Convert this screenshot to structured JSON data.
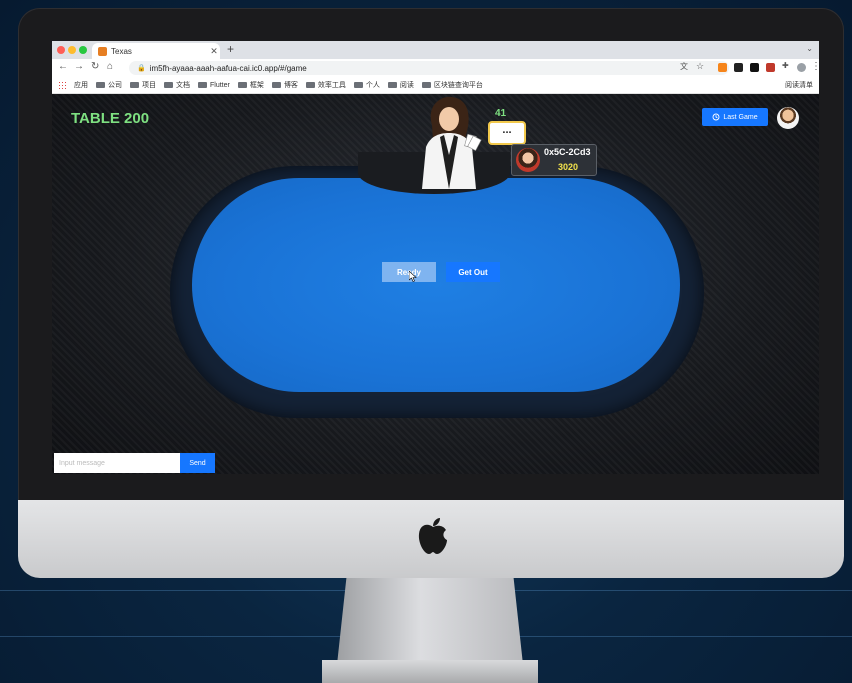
{
  "browser": {
    "tab_title": "Texas",
    "new_tab_symbol": "+",
    "url": "im5fh-ayaaa-aaah-aafua-cai.ic0.app/#/game",
    "bookmarks": [
      "应用",
      "公司",
      "项目",
      "文档",
      "Flutter",
      "框架",
      "博客",
      "效率工具",
      "个人",
      "阅读",
      "区块链查询平台"
    ],
    "reading_list": "阅读清单"
  },
  "game": {
    "table_label": "TABLE 200",
    "last_game_label": "Last Game",
    "countdown": "41",
    "chat_bubble": "...",
    "player": {
      "name": "0x5C-2Cd3",
      "chips": "3020"
    },
    "ready_label": "Ready",
    "get_out_label": "Get Out",
    "message_placeholder": "Input message",
    "send_label": "Send"
  },
  "colors": {
    "accent_blue": "#1677ff",
    "felt_blue": "#1a73d6",
    "table_label_green": "#7ee081",
    "chips_yellow": "#f2e24c"
  },
  "icons": [
    "apple-logo-icon",
    "history-icon",
    "lock-icon",
    "folder-icon",
    "apps-grid-icon"
  ]
}
